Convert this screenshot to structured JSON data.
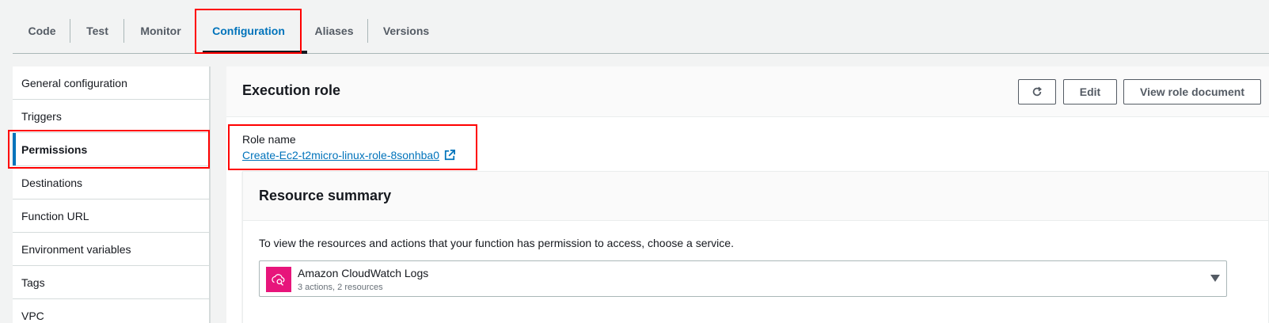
{
  "tabs": [
    {
      "label": "Code"
    },
    {
      "label": "Test"
    },
    {
      "label": "Monitor"
    },
    {
      "label": "Configuration",
      "active": true
    },
    {
      "label": "Aliases"
    },
    {
      "label": "Versions"
    }
  ],
  "sidebar": {
    "items": [
      {
        "label": "General configuration"
      },
      {
        "label": "Triggers"
      },
      {
        "label": "Permissions",
        "active": true
      },
      {
        "label": "Destinations"
      },
      {
        "label": "Function URL"
      },
      {
        "label": "Environment variables"
      },
      {
        "label": "Tags"
      },
      {
        "label": "VPC"
      }
    ]
  },
  "panel": {
    "title": "Execution role",
    "buttons": {
      "refresh_icon": "refresh-icon",
      "edit": "Edit",
      "view_role_document": "View role document"
    },
    "role": {
      "label": "Role name",
      "name": "Create-Ec2-t2micro-linux-role-8sonhba0",
      "link_icon": "external-link-icon"
    }
  },
  "resource_summary": {
    "title": "Resource summary",
    "description": "To view the resources and actions that your function has permission to access, choose a service.",
    "selected_service": {
      "icon": "cloudwatch-logs-icon",
      "name": "Amazon CloudWatch Logs",
      "details": "3 actions, 2 resources"
    }
  },
  "colors": {
    "accent": "#0073bb",
    "highlight": "#ff0000",
    "service_icon_bg": "#e7157b"
  }
}
